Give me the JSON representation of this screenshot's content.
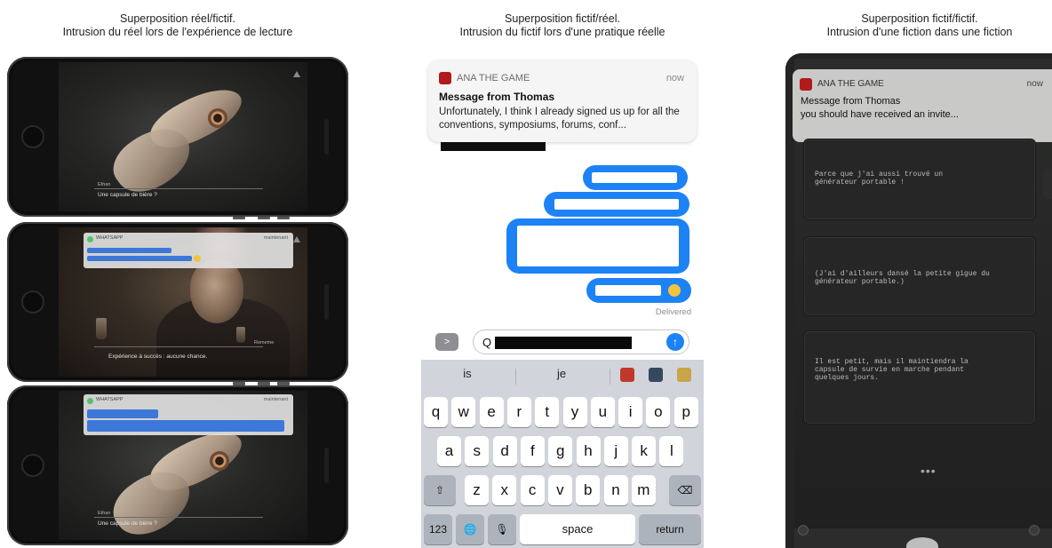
{
  "captions": {
    "left": {
      "line1": "Superposition réel/fictif.",
      "line2": "Intrusion du réel lors de l'expérience de lecture"
    },
    "middle": {
      "line1": "Superposition fictif/réel.",
      "line2": "Intrusion du fictif lors d'une pratique réelle"
    },
    "right": {
      "line1": "Superposition fictif/fictif.",
      "line2": "Intrusion d'une fiction dans une fiction"
    }
  },
  "left_phones": {
    "phone1": {
      "speaker_name": "Ethan",
      "subtitle": "Une capsule de bière ?"
    },
    "phone2": {
      "notif_app": "WHATSAPP",
      "notif_time": "maintenant",
      "subtitle": "Expérience à succès : aucune chance.",
      "subtitle_right": "Rememe"
    },
    "phone3": {
      "notif_app": "WHATSAPP",
      "notif_time": "maintenant",
      "speaker_name": "Ethan",
      "subtitle": "Une capsule de bière ?"
    }
  },
  "middle_phone": {
    "notification": {
      "app_name": "ANA THE GAME",
      "time": "now",
      "sender": "Message from Thomas",
      "body": "Unfortunately, I think I already signed us up for all the conventions, symposiums, forums, conf..."
    },
    "status": "Delivered",
    "input_text": "Q",
    "app_button": ">",
    "send_icon": "up-arrow-icon",
    "keyboard": {
      "suggestions": [
        "is",
        "je"
      ],
      "row1": [
        "q",
        "w",
        "e",
        "r",
        "t",
        "y",
        "u",
        "i",
        "o",
        "p"
      ],
      "row2": [
        "a",
        "s",
        "d",
        "f",
        "g",
        "h",
        "j",
        "k",
        "l"
      ],
      "row3": [
        "z",
        "x",
        "c",
        "v",
        "b",
        "n",
        "m"
      ],
      "shift": "⇧",
      "backspace": "⌫",
      "numbers": "123",
      "globe": "🌐",
      "mic": "🎙",
      "space": "space",
      "return": "return"
    },
    "colors": {
      "bubble": "#1d82f5",
      "keyboard": "#d1d4da"
    }
  },
  "right_phone": {
    "notification": {
      "app_name": "ANA THE GAME",
      "time": "now",
      "sender": "Message from Thomas",
      "body": "you should have received an invite..."
    },
    "messages": [
      "Parce que j'ai aussi trouvé un\ngénérateur portable !",
      "(J'ai d'ailleurs dansé la petite gigue du\ngénérateur portable.)",
      "Il est petit, mais il maintiendra la\ncapsule de survie en marche pendant\nquelques jours."
    ],
    "typing_indicator": "•••"
  }
}
